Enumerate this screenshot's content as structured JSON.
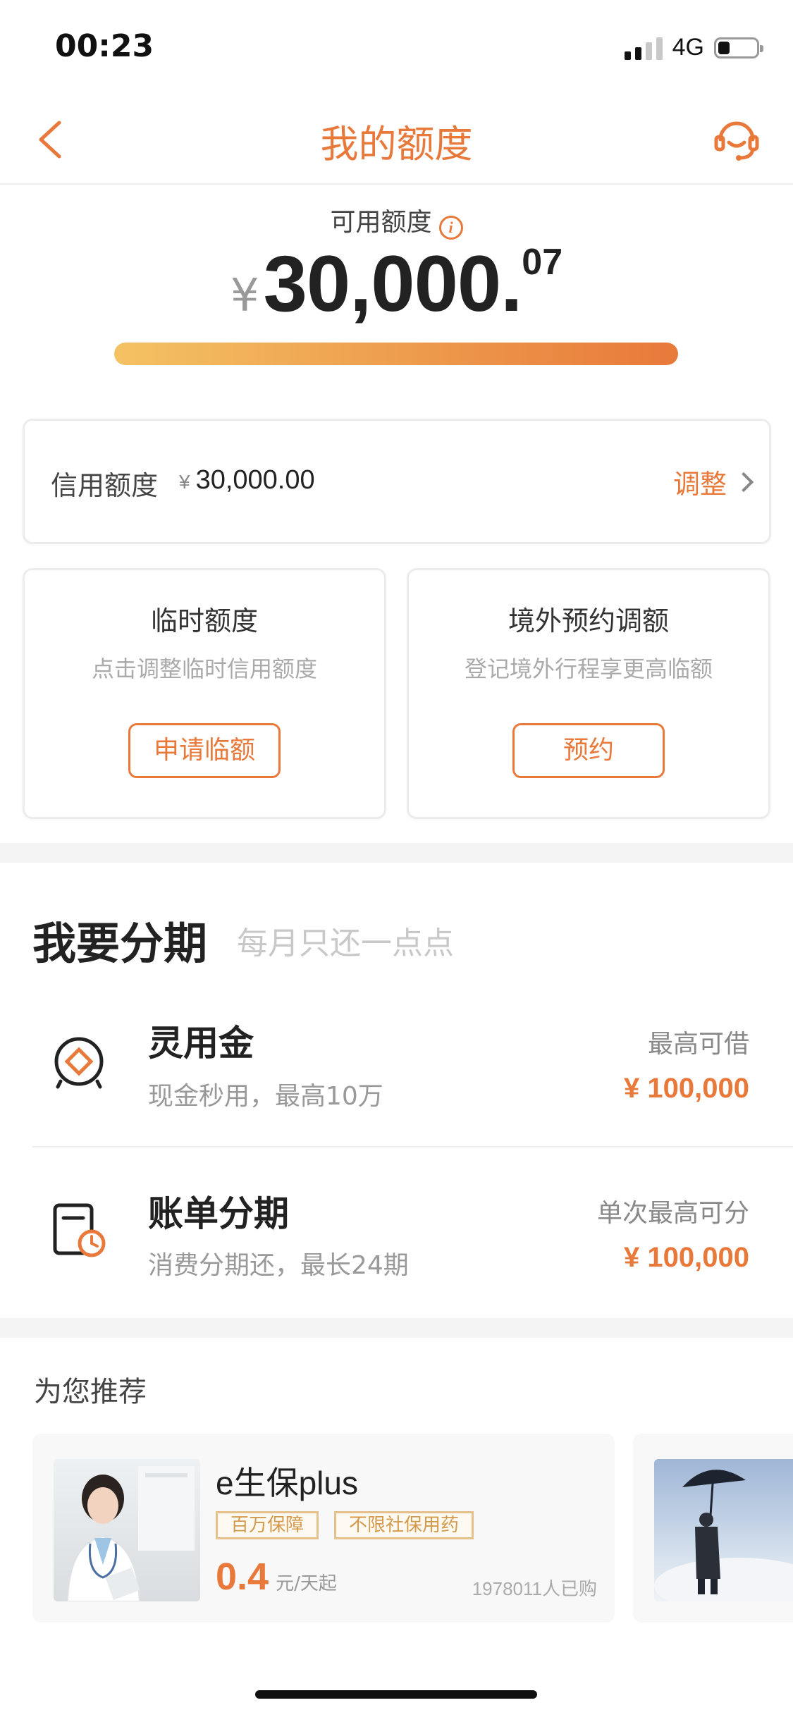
{
  "status": {
    "time": "00:23",
    "network": "4G",
    "battery_level": 0.3
  },
  "nav": {
    "title": "我的额度",
    "back_icon": "chevron-left-icon",
    "service_icon": "headset-icon"
  },
  "available": {
    "label": "可用额度",
    "info_glyph": "i",
    "currency": "¥",
    "amount_int": "30,000.",
    "amount_dec": "07",
    "progress": 1.0
  },
  "credit": {
    "label": "信用额度",
    "currency": "¥",
    "value": "30,000.00",
    "action": "调整"
  },
  "temp": {
    "title": "临时额度",
    "desc": "点击调整临时信用额度",
    "button": "申请临额"
  },
  "overseas": {
    "title": "境外预约调额",
    "desc": "登记境外行程享更高临额",
    "button": "预约"
  },
  "installment": {
    "title": "我要分期",
    "subtitle": "每月只还一点点",
    "rows": [
      {
        "title": "灵用金",
        "desc": "现金秒用，最高10万",
        "right_label": "最高可借",
        "right_value": "¥ 100,000",
        "icon": "coin-wallet-icon"
      },
      {
        "title": "账单分期",
        "desc": "消费分期还，最长24期",
        "right_label": "单次最高可分",
        "right_value": "¥ 100,000",
        "icon": "bill-clock-icon"
      }
    ]
  },
  "recommend": {
    "title": "为您推荐",
    "product": {
      "name": "e生保plus",
      "tags": [
        "百万保障",
        "不限社保用药"
      ],
      "price": "0.4",
      "unit": "元/天起",
      "buyers": "1978011人已购"
    }
  },
  "colors": {
    "accent": "#e8793a",
    "gradient_start": "#f4c263",
    "tag": "#d39a4d"
  }
}
